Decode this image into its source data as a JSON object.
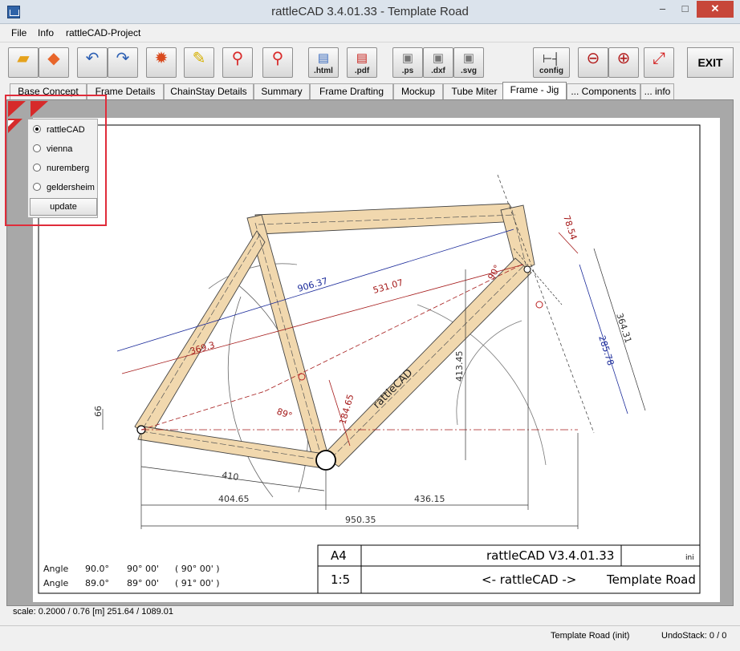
{
  "window": {
    "title": "rattleCAD  3.4.01.33 - Template Road",
    "min": "–",
    "max": "□",
    "close": "✕"
  },
  "menu": {
    "file": "File",
    "info": "Info",
    "project": "rattleCAD-Project"
  },
  "toolbar": {
    "open": "open-folder-icon",
    "save": "save-disk-icon",
    "html": ".html",
    "pdf": ".pdf",
    "ps": ".ps",
    "dxf": ".dxf",
    "svg": ".svg",
    "config": "config",
    "exit": "EXIT"
  },
  "tabs": [
    "Base Concept",
    "Frame Details",
    "ChainStay Details",
    "Summary",
    "Frame Drafting",
    "Mockup",
    "Tube Miter",
    "Frame - Jig",
    "... Components",
    "... info"
  ],
  "jig": {
    "options": [
      "rattleCAD",
      "vienna",
      "nuremberg",
      "geldersheim"
    ],
    "selected": "rattleCAD",
    "update": "update"
  },
  "drawing": {
    "dims": {
      "d906": "906.37",
      "d531": "531.07",
      "d369": "369.3",
      "d184": "184.65",
      "d413": "413.45",
      "d78": "78.54",
      "d364": "364.31",
      "d285": "285.78",
      "d410": "410",
      "d404": "404.65",
      "d436": "436.15",
      "d950": "950.35",
      "d66": "66",
      "a90": "90°",
      "a89": "89°"
    },
    "logo_text": "rattleCAD",
    "angles": {
      "row1": [
        "Angle",
        "90.0°",
        "90° 00'",
        "( 90° 00' )"
      ],
      "row2": [
        "Angle",
        "89.0°",
        "89° 00'",
        "( 91° 00' )"
      ]
    },
    "titleblock": {
      "size": "A4",
      "app": "rattleCAD   V3.4.01.33",
      "ini": "ini",
      "scale": "1:5",
      "nav": "<- rattleCAD ->",
      "project": "Template Road"
    }
  },
  "status": {
    "scale": "scale: 0.2000 / 0.76  [m]  251.64 / 1089.01",
    "project": "Template Road (init)",
    "undo": "UndoStack:  0 / 0"
  }
}
